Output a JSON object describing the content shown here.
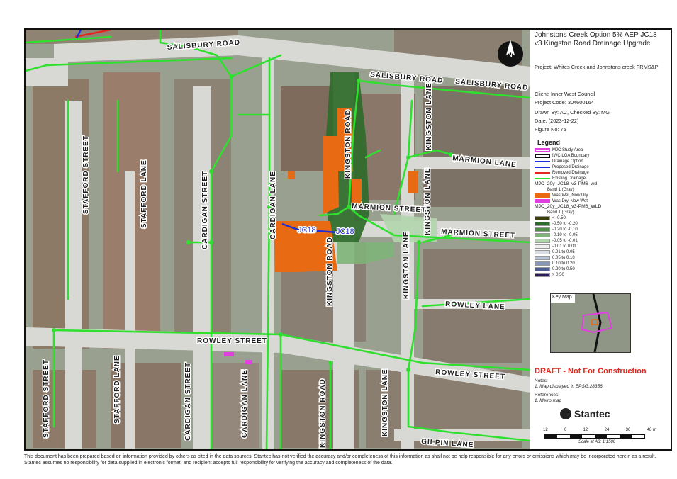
{
  "title": "Johnstons Creek Option 5% AEP JC18 v3 Kingston Road Drainage Upgrade",
  "project": "Project:  Whites Creek and Johnstons creek FRMS&P",
  "client": "Client:  Inner West Council",
  "project_code": "Project Code:  304600164",
  "drawn_by": "Drawn By:  AC, Checked By: MG",
  "date": "Date:  (2023-12-22)",
  "figure_no": "Figure No:  75",
  "legend": {
    "title": "Legend",
    "items": [
      {
        "label": "MJC Study Area",
        "color": "#e040e0"
      },
      {
        "label": "IWC LGA Boundary",
        "color": "#111111"
      },
      {
        "label": "Drainage Option",
        "color": "#1f2fd6"
      },
      {
        "label": "Proposed Drainage",
        "color": "#1f2fd6"
      },
      {
        "label": "Removed Drainage",
        "color": "#e3261f"
      },
      {
        "label": "Existing Drainage",
        "color": "#2fe02f"
      }
    ],
    "group1_title": "MJC_20y_JC18_v3-PM6_wd",
    "group1_band": "Band 1 (Gray)",
    "group1_items": [
      {
        "label": "Was Wet, Now Dry",
        "color": "#e86a12"
      },
      {
        "label": "Was Dry, Now Wet",
        "color": "#e040e0"
      }
    ],
    "group2_title": "MJC_20y_JC18_v3-PM6_WLD",
    "group2_band": "Band 1 (Gray)",
    "group2_items": [
      {
        "label": "< -0.50",
        "color": "#3b3f0c"
      },
      {
        "label": "-0.50 to -0.20",
        "color": "#2f6b2a"
      },
      {
        "label": "-0.20 to -0.10",
        "color": "#4f8f48"
      },
      {
        "label": "-0.10 to -0.05",
        "color": "#7fb479"
      },
      {
        "label": "-0.05 to -0.01",
        "color": "#b2d4ad"
      },
      {
        "label": "-0.01 to 0.01",
        "color": "#eef0ee"
      },
      {
        "label": "0.01 to 0.05",
        "color": "#d8dde6"
      },
      {
        "label": "0.05 to 0.10",
        "color": "#b8c3d6"
      },
      {
        "label": "0.10 to 0.20",
        "color": "#8797b8"
      },
      {
        "label": "0.20 to 0.50",
        "color": "#4d5f92"
      },
      {
        "label": "> 0.50",
        "color": "#2b1d57"
      }
    ]
  },
  "key_map_label": "Key Map",
  "draft_label": "DRAFT - Not For Construction",
  "notes_title": "Notes:",
  "notes_text": "1. Map displayed in EPSG:28356",
  "references_title": "References:",
  "references_text": "1. Metro map",
  "brand": "Stantec",
  "scale": {
    "ticks": [
      "12",
      "0",
      "12",
      "24",
      "36",
      "48 m"
    ],
    "label": "Scale at A3: 1:1500"
  },
  "north_label": "N",
  "streets": {
    "salisbury_1": "SALISBURY ROAD",
    "salisbury_2": "SALISBURY ROAD",
    "salisbury_3": "SALISBURY ROAD",
    "stafford_street_1": "STAFFORD STREET",
    "stafford_street_2": "STAFFORD STREET",
    "stafford_lane_1": "STAFFORD LANE",
    "stafford_lane_2": "STAFFORD LANE",
    "cardigan_street_1": "CARDIGAN STREET",
    "cardigan_street_2": "CARDIGAN STREET",
    "cardigan_lane_1": "CARDIGAN LANE",
    "cardigan_lane_2": "CARDIGAN LANE",
    "kingston_road_1": "KINGSTON ROAD",
    "kingston_road_2": "KINGSTON ROAD",
    "kingston_road_3": "KINGSTON ROAD",
    "kingston_lane_1": "KINGSTON LANE",
    "kingston_lane_2": "KINGSTON LANE",
    "kingston_lane_3": "KINGSTON LANE",
    "kingston_lane_4": "KINGSTON LANE",
    "marmion_lane": "MARMION LANE",
    "marmion_street_1": "MARMION STREET",
    "marmion_street_2": "MARMION STREET",
    "rowley_lane": "ROWLEY LANE",
    "rowley_street_1": "ROWLEY STREET",
    "rowley_street_2": "ROWLEY STREET",
    "gilpin_lane": "GILPIN LANE"
  },
  "option_labels": {
    "a": "JC18",
    "b": "JC18"
  },
  "disclaimer": "This document has been prepared based on information provided by others as cited in the data sources. Stantec has not verified the accuracy and/or completeness of this information as shall not be help responsible for any errors or omissions which may be incorporated herein as a result. Stantec assumes no responsibility for data supplied in electronic format, and recipient accepts full responsibility for verifying the accuracy and completeness of the data.",
  "colors": {
    "existing_drainage": "#2fe02f",
    "option": "#1f2fd6",
    "removed": "#e3261f",
    "wet_dry": "#e86a12",
    "dry_wet": "#e040e0"
  }
}
